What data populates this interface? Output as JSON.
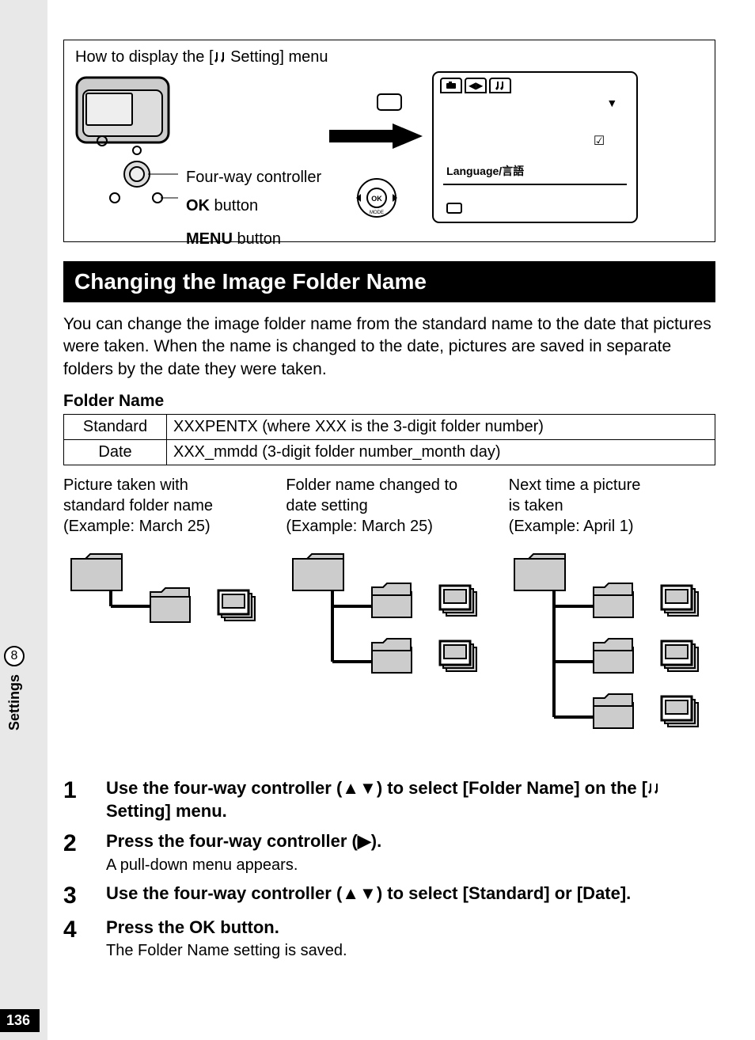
{
  "page_number": "136",
  "side_tab": {
    "number": "8",
    "label": "Settings"
  },
  "howto": {
    "title_prefix": "How to display the [",
    "title_suffix": " Setting] menu",
    "labels": {
      "fourway": "Four-way controller",
      "ok_bold": "OK",
      "ok_suffix": " button",
      "menu_bold": "MENU",
      "menu_suffix": " button"
    },
    "screen": {
      "lang": "Language/言語",
      "check": "☑",
      "arrow": "▼"
    }
  },
  "section": {
    "heading": "Changing the Image Folder Name",
    "para": "You can change the image folder name from the standard name to the date that pictures were taken. When the name is changed to the date, pictures are saved in separate folders by the date they were taken.",
    "subhead": "Folder Name",
    "table": {
      "rows": [
        {
          "k": "Standard",
          "v": "XXXPENTX (where XXX is the 3-digit folder number)"
        },
        {
          "k": "Date",
          "v": "XXX_mmdd (3-digit folder number_month day)"
        }
      ]
    },
    "caps": {
      "c1a": "Picture taken with",
      "c1b": "standard folder name",
      "c1c": "(Example: March 25)",
      "c2a": "Folder name changed to",
      "c2b": "date setting",
      "c2c": "(Example: March 25)",
      "c3a": "Next time a picture",
      "c3b": "is taken",
      "c3c": "(Example: April 1)"
    }
  },
  "steps": {
    "s1_a": "Use the four-way controller (▲▼) to select [Folder Name] on the [",
    "s1_b": " Setting] menu.",
    "s2_main": "Press the four-way controller (▶).",
    "s2_sub": "A pull-down menu appears.",
    "s3": "Use the four-way controller (▲▼) to select [Standard] or [Date].",
    "s4_a": "Press the ",
    "s4_b": "OK",
    "s4_c": " button.",
    "s4_sub": "The Folder Name setting is saved."
  }
}
